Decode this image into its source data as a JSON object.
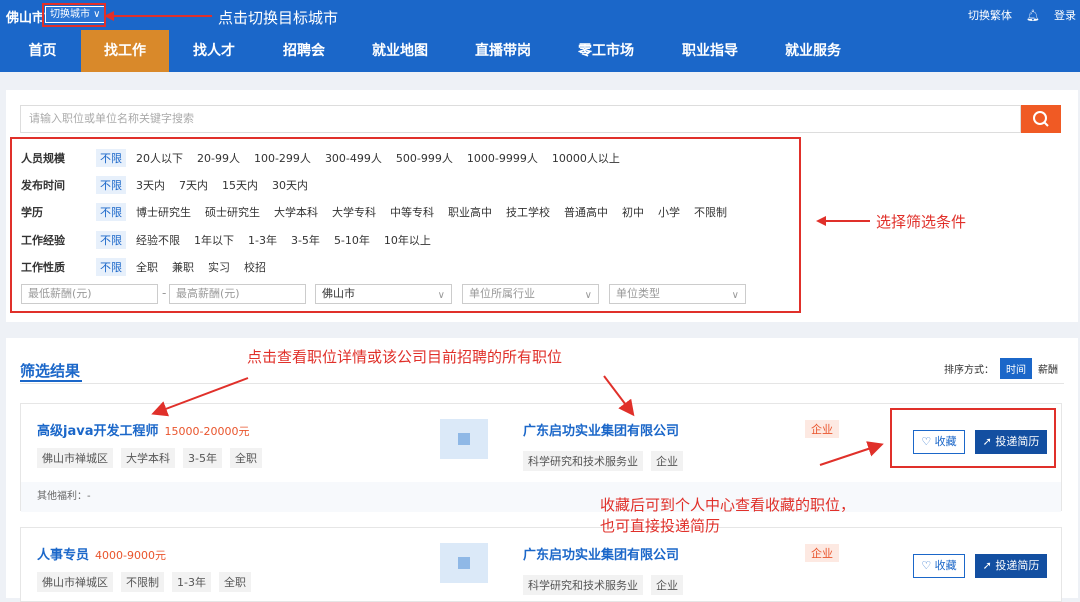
{
  "topbar": {
    "city": "佛山市",
    "switch_city": "切换城市",
    "annotation": "点击切换目标城市",
    "toggle_lang": "切换繁体",
    "login": "登录"
  },
  "nav": [
    "首页",
    "找工作",
    "找人才",
    "招聘会",
    "就业地图",
    "直播带岗",
    "零工市场",
    "职业指导",
    "就业服务"
  ],
  "search": {
    "placeholder": "请输入职位或单位名称关键字搜索"
  },
  "filters": {
    "size": {
      "label": "人员规模",
      "options": [
        "不限",
        "20人以下",
        "20-99人",
        "100-299人",
        "300-499人",
        "500-999人",
        "1000-9999人",
        "10000人以上"
      ]
    },
    "time": {
      "label": "发布时间",
      "options": [
        "不限",
        "3天内",
        "7天内",
        "15天内",
        "30天内"
      ]
    },
    "edu": {
      "label": "学历",
      "options": [
        "不限",
        "博士研究生",
        "硕士研究生",
        "大学本科",
        "大学专科",
        "中等专科",
        "职业高中",
        "技工学校",
        "普通高中",
        "初中",
        "小学",
        "不限制"
      ]
    },
    "exp": {
      "label": "工作经验",
      "options": [
        "不限",
        "经验不限",
        "1年以下",
        "1-3年",
        "3-5年",
        "5-10年",
        "10年以上"
      ]
    },
    "nature": {
      "label": "工作性质",
      "options": [
        "不限",
        "全职",
        "兼职",
        "实习",
        "校招"
      ]
    },
    "min_salary": "最低薪酬(元)",
    "dash": "-",
    "max_salary": "最高薪酬(元)",
    "city_select": "佛山市",
    "industry_select": "单位所属行业",
    "type_select": "单位类型"
  },
  "annotations": {
    "filter": "选择筛选条件",
    "detail": "点击查看职位详情或该公司目前招聘的所有职位",
    "fav_line1": "收藏后可到个人中心查看收藏的职位，",
    "fav_line2": "也可直接投递简历"
  },
  "results": {
    "title": "筛选结果",
    "sort_label": "排序方式：",
    "sort_time": "时间",
    "sort_salary": "薪酬",
    "jobs": [
      {
        "title": "高级java开发工程师",
        "salary": "15000-20000元",
        "tags": [
          "佛山市禅城区",
          "大学本科",
          "3-5年",
          "全职"
        ],
        "company": "广东启功实业集团有限公司",
        "company_type": "企业",
        "company_tags": [
          "科学研究和技术服务业",
          "企业"
        ],
        "welfare": "其他福利：-",
        "fav": "收藏",
        "send": "投递简历"
      },
      {
        "title": "人事专员",
        "salary": "4000-9000元",
        "tags": [
          "佛山市禅城区",
          "不限制",
          "1-3年",
          "全职"
        ],
        "company": "广东启功实业集团有限公司",
        "company_type": "企业",
        "company_tags": [
          "科学研究和技术服务业",
          "企业"
        ],
        "fav": "收藏",
        "send": "投递简历"
      }
    ]
  }
}
